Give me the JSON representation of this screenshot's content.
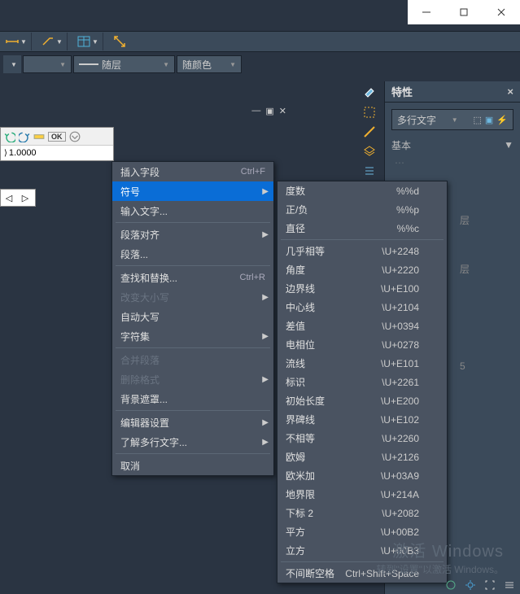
{
  "titlebar": {
    "min": "—",
    "max": "▢",
    "close": "×"
  },
  "layer": {
    "bylayer": "随层",
    "bycolor": "随颜色"
  },
  "panelmini": {
    "minimize": "—",
    "restore": "▣",
    "close": "✕",
    "value": "1.0000",
    "ok": "OK"
  },
  "properties": {
    "title": "特性",
    "seltype": "多行文字",
    "sec_basic": "基本",
    "layer_lbl": "层",
    "layer_val": "层",
    "height_val": "5"
  },
  "ctx": {
    "insert_field": "插入字段",
    "insert_field_sc": "Ctrl+F",
    "symbol": "符号",
    "import_text": "输入文字...",
    "para_align": "段落对齐",
    "paragraph": "段落...",
    "find_replace": "查找和替换...",
    "find_replace_sc": "Ctrl+R",
    "change_case": "改变大小写",
    "auto_caps": "自动大写",
    "charset": "字符集",
    "merge_para": "合并段落",
    "del_format": "删除格式",
    "bgmask": "背景遮罩...",
    "editor_settings": "编辑器设置",
    "learn_mtext": "了解多行文字...",
    "cancel": "取消"
  },
  "symbols": [
    {
      "name": "度数",
      "code": "%%d"
    },
    {
      "name": "正/负",
      "code": "%%p"
    },
    {
      "name": "直径",
      "code": "%%c"
    },
    {
      "sep": true
    },
    {
      "name": "几乎相等",
      "code": "\\U+2248"
    },
    {
      "name": "角度",
      "code": "\\U+2220"
    },
    {
      "name": "边界线",
      "code": "\\U+E100"
    },
    {
      "name": "中心线",
      "code": "\\U+2104"
    },
    {
      "name": "差值",
      "code": "\\U+0394"
    },
    {
      "name": "电相位",
      "code": "\\U+0278"
    },
    {
      "name": "流线",
      "code": "\\U+E101"
    },
    {
      "name": "标识",
      "code": "\\U+2261"
    },
    {
      "name": "初始长度",
      "code": "\\U+E200"
    },
    {
      "name": "界碑线",
      "code": "\\U+E102"
    },
    {
      "name": "不相等",
      "code": "\\U+2260"
    },
    {
      "name": "欧姆",
      "code": "\\U+2126"
    },
    {
      "name": "欧米加",
      "code": "\\U+03A9"
    },
    {
      "name": "地界限",
      "code": "\\U+214A"
    },
    {
      "name": "下标 2",
      "code": "\\U+2082"
    },
    {
      "name": "平方",
      "code": "\\U+00B2"
    },
    {
      "name": "立方",
      "code": "\\U+00B3"
    },
    {
      "sep": true
    },
    {
      "name": "不间断空格",
      "code": "Ctrl+Shift+Space"
    }
  ],
  "wm": {
    "l1": "激活 Windows",
    "l2": "转到\"设置\"以激活 Windows。"
  }
}
